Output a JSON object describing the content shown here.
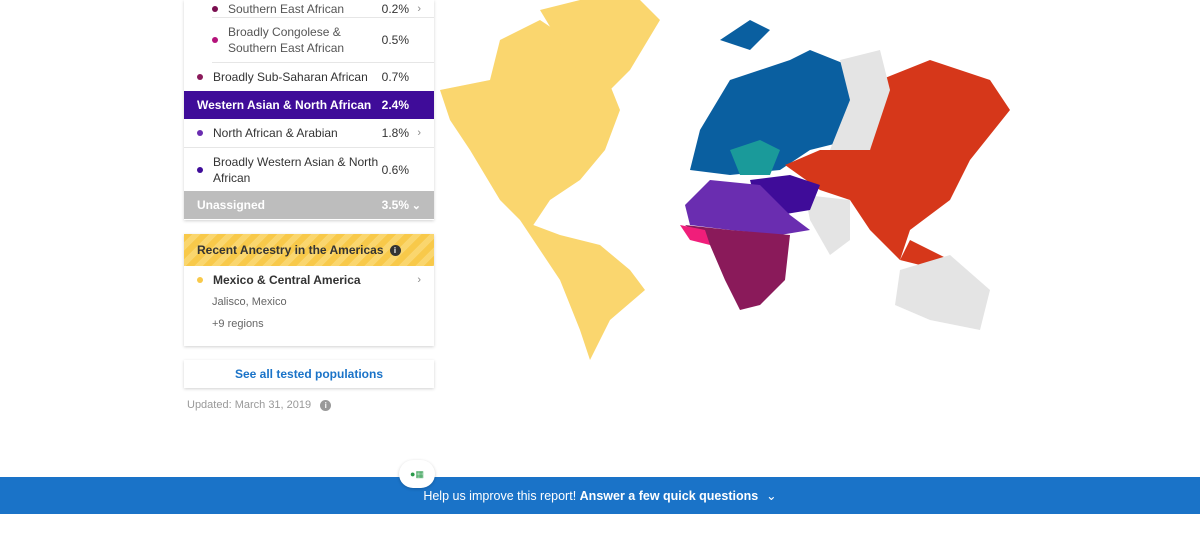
{
  "ancestry_list": {
    "items": [
      {
        "label": "Southern East African",
        "pct": "0.2%",
        "color": "#7a0e4f",
        "chevron": true
      },
      {
        "label": "Broadly Congolese & Southern East African",
        "pct": "0.5%",
        "color": "#b4127a"
      },
      {
        "label": "Broadly Sub-Saharan African",
        "pct": "0.7%",
        "color": "#8a1a5a"
      }
    ],
    "western_asian": {
      "label": "Western Asian & North African",
      "pct": "2.4%",
      "color": "#3f0c99"
    },
    "western_items": [
      {
        "label": "North African & Arabian",
        "pct": "1.8%",
        "color": "#6a2db0",
        "chevron": true
      },
      {
        "label": "Broadly Western Asian & North African",
        "pct": "0.6%",
        "color": "#3f0c99"
      }
    ],
    "unassigned": {
      "label": "Unassigned",
      "pct": "3.5%",
      "color": "#bdbdbd"
    }
  },
  "recent_ancestry": {
    "title": "Recent Ancestry in the Americas",
    "region": "Mexico & Central America",
    "subregion": "Jalisco, Mexico",
    "more": "+9 regions",
    "color": "#f8c94a"
  },
  "see_all": "See all tested populations",
  "updated": "Updated: March 31, 2019",
  "banner": {
    "text": "Help us improve this report!",
    "link": "Answer a few quick questions",
    "color": "#1a73c8"
  },
  "map_colors": {
    "americas": "#fad66e",
    "europe": "#0a5fa0",
    "eastern_europe": "#1a9a9a",
    "east_asia": "#d6371a",
    "unassigned": "#e4e4e4",
    "north_africa": "#6a2db0",
    "west_asia": "#3f0c99",
    "sub_saharan": "#8a1a5a",
    "west_africa": "#f01e7a"
  }
}
